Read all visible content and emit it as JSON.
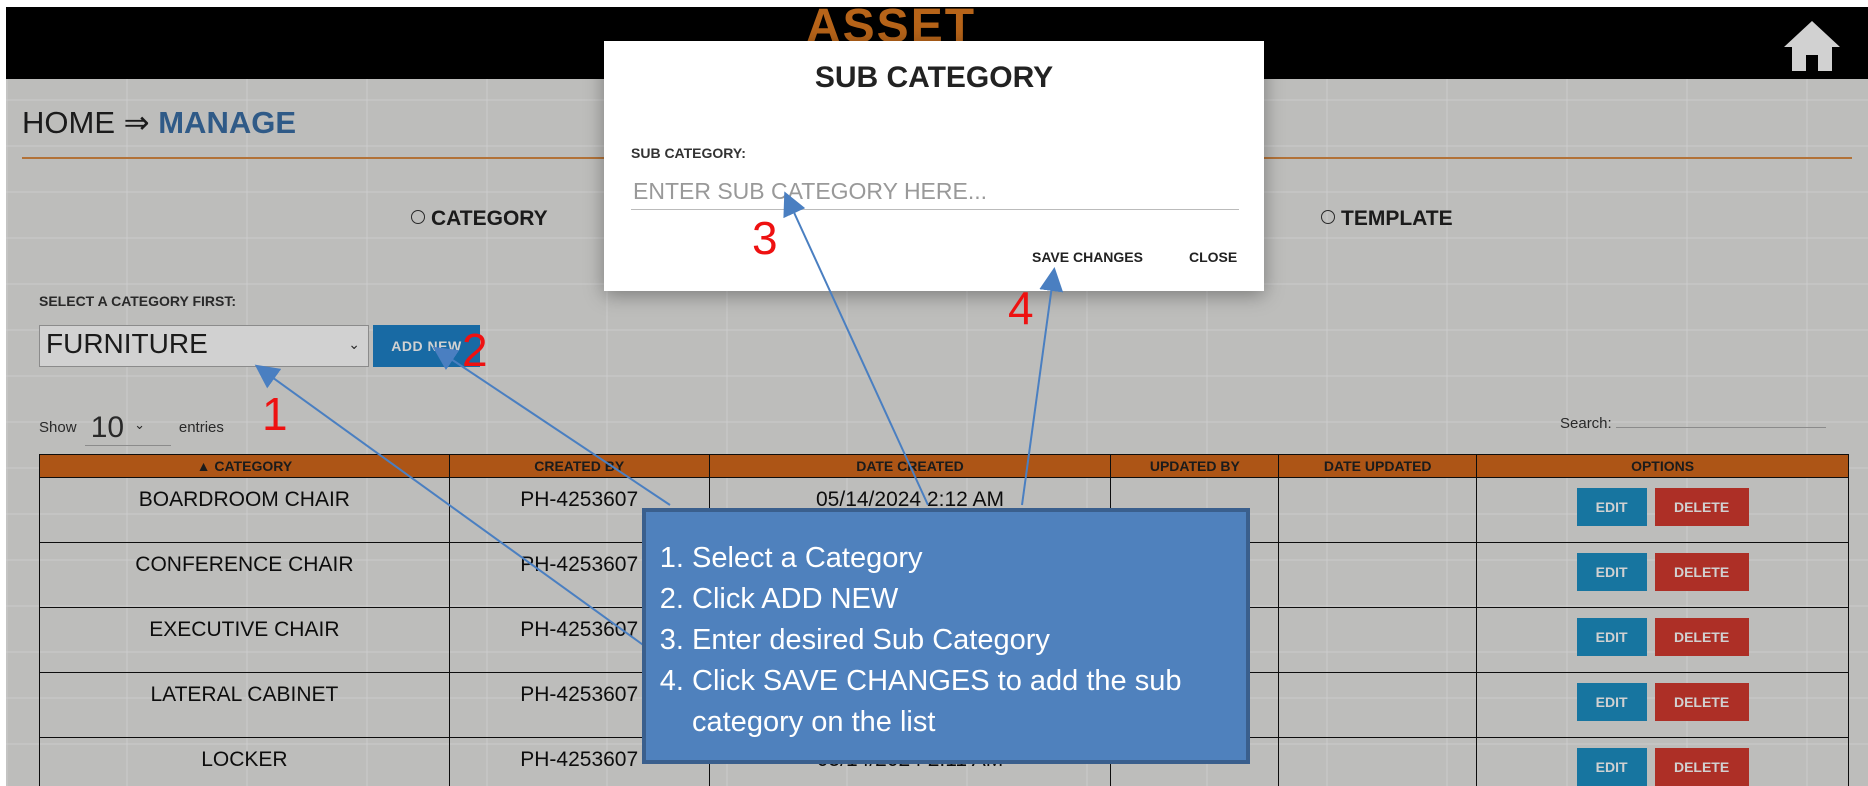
{
  "header": {
    "app_title": "ASSET"
  },
  "breadcrumb": {
    "root": "HOME",
    "separator": "⇒",
    "current": "MANAGE"
  },
  "tabs": [
    {
      "label": "CATEGORY"
    },
    {
      "label": "TEMPLATE"
    }
  ],
  "filters": {
    "select_label": "SELECT A CATEGORY FIRST:",
    "selected_category": "FURNITURE",
    "add_new_label": "ADD NEW"
  },
  "table_controls": {
    "show_label": "Show",
    "entries_value": "10",
    "entries_label": "entries",
    "search_label": "Search:"
  },
  "table": {
    "columns": [
      "▲ CATEGORY",
      "CREATED BY",
      "DATE CREATED",
      "UPDATED BY",
      "DATE UPDATED",
      "OPTIONS"
    ],
    "rows": [
      {
        "category": "BOARDROOM CHAIR",
        "created_by": "PH-4253607",
        "date_created": "05/14/2024 2:12 AM",
        "updated_by": "",
        "date_updated": ""
      },
      {
        "category": "CONFERENCE CHAIR",
        "created_by": "PH-4253607",
        "date_created": "",
        "updated_by": "",
        "date_updated": ""
      },
      {
        "category": "EXECUTIVE CHAIR",
        "created_by": "PH-4253607",
        "date_created": "",
        "updated_by": "",
        "date_updated": ""
      },
      {
        "category": "LATERAL CABINET",
        "created_by": "PH-4253607",
        "date_created": "",
        "updated_by": "",
        "date_updated": ""
      },
      {
        "category": "LOCKER",
        "created_by": "PH-4253607",
        "date_created": "05/14/2024 2:11 AM",
        "updated_by": "",
        "date_updated": ""
      }
    ],
    "edit_label": "EDIT",
    "delete_label": "DELETE"
  },
  "modal": {
    "title": "SUB CATEGORY",
    "field_label": "SUB CATEGORY:",
    "placeholder": "ENTER SUB CATEGORY HERE...",
    "save_label": "SAVE CHANGES",
    "close_label": "CLOSE"
  },
  "callout": {
    "steps": [
      "Select a Category",
      "Click ADD NEW",
      "Enter desired Sub Category",
      "Click SAVE CHANGES to add the sub category on the list"
    ]
  },
  "markers": [
    "1",
    "2",
    "3",
    "4"
  ],
  "colors": {
    "topbar": "#000000",
    "accent_orange": "#d3681c",
    "primary_blue": "#1e82c9",
    "danger_red": "#d43a2f",
    "callout_blue": "#4f81bd",
    "marker_red": "#ee1111"
  }
}
